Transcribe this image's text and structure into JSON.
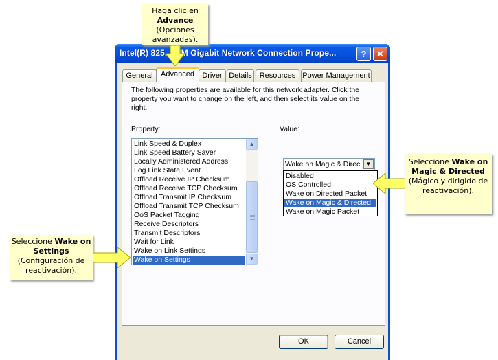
{
  "window": {
    "title": "Intel(R) 825... MM Gigabit Network Connection Prope...",
    "help_label": "?",
    "close_label": "✕"
  },
  "tabs": [
    {
      "label": "General"
    },
    {
      "label": "Advanced",
      "active": true
    },
    {
      "label": "Driver"
    },
    {
      "label": "Details"
    },
    {
      "label": "Resources"
    },
    {
      "label": "Power Management"
    }
  ],
  "description": "The following properties are available for this network adapter. Click the property you want to change on the left, and then select its value on the right.",
  "property_label": "Property:",
  "value_label": "Value:",
  "properties": [
    "Link Speed & Duplex",
    "Link Speed Battery Saver",
    "Locally Administered Address",
    "Log Link State Event",
    "Offload Receive IP Checksum",
    "Offload Receive TCP Checksum",
    "Offload Transmit IP Checksum",
    "Offload Transmit TCP Checksum",
    "QoS Packet Tagging",
    "Receive Descriptors",
    "Transmit Descriptors",
    "Wait for Link",
    "Wake on Link Settings",
    "Wake on Settings"
  ],
  "selected_property": "Wake on Settings",
  "value": {
    "current": "Wake on Magic & Direc",
    "options": [
      "Disabled",
      "OS Controlled",
      "Wake on Directed Packet",
      "Wake on Magic & Directed",
      "Wake on Magic Packet"
    ],
    "selected": "Wake on Magic & Directed"
  },
  "buttons": {
    "ok": "OK",
    "cancel": "Cancel"
  },
  "callouts": {
    "advanced": {
      "line1": "Haga clic en",
      "bold": "Advance",
      "rest": "(Opciones avanzadas)."
    },
    "wake_settings": {
      "line1": "Seleccione",
      "bold": "Wake on Settings",
      "rest": "(Configuración de reactivación)."
    },
    "magic_directed": {
      "line1": "Seleccione",
      "bold": "Wake on Magic & Directed",
      "rest": "(Mágico y dirigido de reactivación)."
    }
  },
  "colors": {
    "titlebar": "#0550dc",
    "selection": "#316ac5",
    "callout_bg": "#ffffcc",
    "arrow_fill": "#ffff66"
  },
  "icons": [
    "help-icon",
    "close-icon",
    "scroll-up-icon",
    "scroll-down-icon",
    "dropdown-arrow-icon"
  ]
}
